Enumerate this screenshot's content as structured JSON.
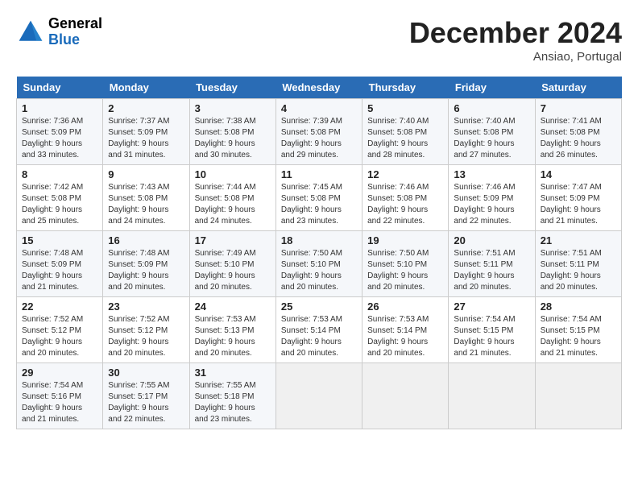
{
  "header": {
    "logo_general": "General",
    "logo_blue": "Blue",
    "title": "December 2024",
    "location": "Ansiao, Portugal"
  },
  "weekdays": [
    "Sunday",
    "Monday",
    "Tuesday",
    "Wednesday",
    "Thursday",
    "Friday",
    "Saturday"
  ],
  "weeks": [
    [
      {
        "day": "1",
        "sunrise": "Sunrise: 7:36 AM",
        "sunset": "Sunset: 5:09 PM",
        "daylight": "Daylight: 9 hours and 33 minutes."
      },
      {
        "day": "2",
        "sunrise": "Sunrise: 7:37 AM",
        "sunset": "Sunset: 5:09 PM",
        "daylight": "Daylight: 9 hours and 31 minutes."
      },
      {
        "day": "3",
        "sunrise": "Sunrise: 7:38 AM",
        "sunset": "Sunset: 5:08 PM",
        "daylight": "Daylight: 9 hours and 30 minutes."
      },
      {
        "day": "4",
        "sunrise": "Sunrise: 7:39 AM",
        "sunset": "Sunset: 5:08 PM",
        "daylight": "Daylight: 9 hours and 29 minutes."
      },
      {
        "day": "5",
        "sunrise": "Sunrise: 7:40 AM",
        "sunset": "Sunset: 5:08 PM",
        "daylight": "Daylight: 9 hours and 28 minutes."
      },
      {
        "day": "6",
        "sunrise": "Sunrise: 7:40 AM",
        "sunset": "Sunset: 5:08 PM",
        "daylight": "Daylight: 9 hours and 27 minutes."
      },
      {
        "day": "7",
        "sunrise": "Sunrise: 7:41 AM",
        "sunset": "Sunset: 5:08 PM",
        "daylight": "Daylight: 9 hours and 26 minutes."
      }
    ],
    [
      {
        "day": "8",
        "sunrise": "Sunrise: 7:42 AM",
        "sunset": "Sunset: 5:08 PM",
        "daylight": "Daylight: 9 hours and 25 minutes."
      },
      {
        "day": "9",
        "sunrise": "Sunrise: 7:43 AM",
        "sunset": "Sunset: 5:08 PM",
        "daylight": "Daylight: 9 hours and 24 minutes."
      },
      {
        "day": "10",
        "sunrise": "Sunrise: 7:44 AM",
        "sunset": "Sunset: 5:08 PM",
        "daylight": "Daylight: 9 hours and 24 minutes."
      },
      {
        "day": "11",
        "sunrise": "Sunrise: 7:45 AM",
        "sunset": "Sunset: 5:08 PM",
        "daylight": "Daylight: 9 hours and 23 minutes."
      },
      {
        "day": "12",
        "sunrise": "Sunrise: 7:46 AM",
        "sunset": "Sunset: 5:08 PM",
        "daylight": "Daylight: 9 hours and 22 minutes."
      },
      {
        "day": "13",
        "sunrise": "Sunrise: 7:46 AM",
        "sunset": "Sunset: 5:09 PM",
        "daylight": "Daylight: 9 hours and 22 minutes."
      },
      {
        "day": "14",
        "sunrise": "Sunrise: 7:47 AM",
        "sunset": "Sunset: 5:09 PM",
        "daylight": "Daylight: 9 hours and 21 minutes."
      }
    ],
    [
      {
        "day": "15",
        "sunrise": "Sunrise: 7:48 AM",
        "sunset": "Sunset: 5:09 PM",
        "daylight": "Daylight: 9 hours and 21 minutes."
      },
      {
        "day": "16",
        "sunrise": "Sunrise: 7:48 AM",
        "sunset": "Sunset: 5:09 PM",
        "daylight": "Daylight: 9 hours and 20 minutes."
      },
      {
        "day": "17",
        "sunrise": "Sunrise: 7:49 AM",
        "sunset": "Sunset: 5:10 PM",
        "daylight": "Daylight: 9 hours and 20 minutes."
      },
      {
        "day": "18",
        "sunrise": "Sunrise: 7:50 AM",
        "sunset": "Sunset: 5:10 PM",
        "daylight": "Daylight: 9 hours and 20 minutes."
      },
      {
        "day": "19",
        "sunrise": "Sunrise: 7:50 AM",
        "sunset": "Sunset: 5:10 PM",
        "daylight": "Daylight: 9 hours and 20 minutes."
      },
      {
        "day": "20",
        "sunrise": "Sunrise: 7:51 AM",
        "sunset": "Sunset: 5:11 PM",
        "daylight": "Daylight: 9 hours and 20 minutes."
      },
      {
        "day": "21",
        "sunrise": "Sunrise: 7:51 AM",
        "sunset": "Sunset: 5:11 PM",
        "daylight": "Daylight: 9 hours and 20 minutes."
      }
    ],
    [
      {
        "day": "22",
        "sunrise": "Sunrise: 7:52 AM",
        "sunset": "Sunset: 5:12 PM",
        "daylight": "Daylight: 9 hours and 20 minutes."
      },
      {
        "day": "23",
        "sunrise": "Sunrise: 7:52 AM",
        "sunset": "Sunset: 5:12 PM",
        "daylight": "Daylight: 9 hours and 20 minutes."
      },
      {
        "day": "24",
        "sunrise": "Sunrise: 7:53 AM",
        "sunset": "Sunset: 5:13 PM",
        "daylight": "Daylight: 9 hours and 20 minutes."
      },
      {
        "day": "25",
        "sunrise": "Sunrise: 7:53 AM",
        "sunset": "Sunset: 5:14 PM",
        "daylight": "Daylight: 9 hours and 20 minutes."
      },
      {
        "day": "26",
        "sunrise": "Sunrise: 7:53 AM",
        "sunset": "Sunset: 5:14 PM",
        "daylight": "Daylight: 9 hours and 20 minutes."
      },
      {
        "day": "27",
        "sunrise": "Sunrise: 7:54 AM",
        "sunset": "Sunset: 5:15 PM",
        "daylight": "Daylight: 9 hours and 21 minutes."
      },
      {
        "day": "28",
        "sunrise": "Sunrise: 7:54 AM",
        "sunset": "Sunset: 5:15 PM",
        "daylight": "Daylight: 9 hours and 21 minutes."
      }
    ],
    [
      {
        "day": "29",
        "sunrise": "Sunrise: 7:54 AM",
        "sunset": "Sunset: 5:16 PM",
        "daylight": "Daylight: 9 hours and 21 minutes."
      },
      {
        "day": "30",
        "sunrise": "Sunrise: 7:55 AM",
        "sunset": "Sunset: 5:17 PM",
        "daylight": "Daylight: 9 hours and 22 minutes."
      },
      {
        "day": "31",
        "sunrise": "Sunrise: 7:55 AM",
        "sunset": "Sunset: 5:18 PM",
        "daylight": "Daylight: 9 hours and 23 minutes."
      },
      null,
      null,
      null,
      null
    ]
  ]
}
